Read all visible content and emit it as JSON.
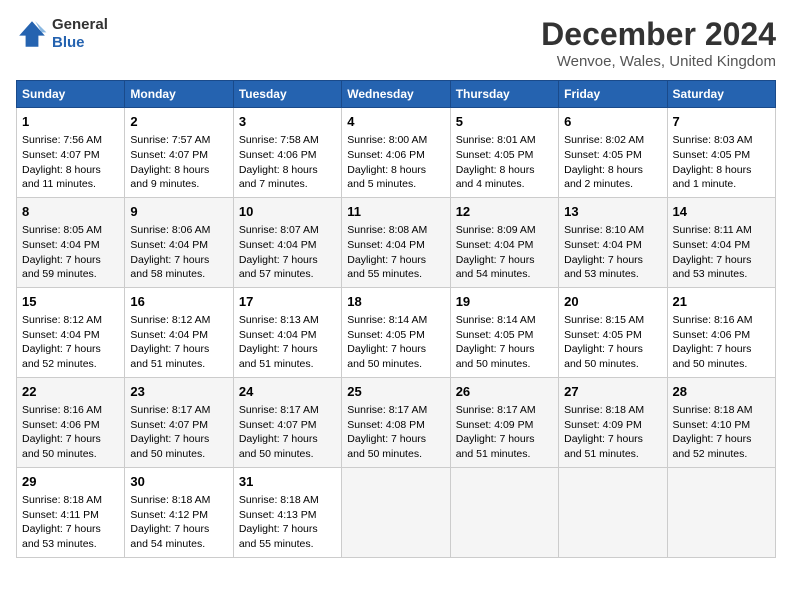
{
  "header": {
    "logo_line1": "General",
    "logo_line2": "Blue",
    "title": "December 2024",
    "subtitle": "Wenvoe, Wales, United Kingdom"
  },
  "columns": [
    "Sunday",
    "Monday",
    "Tuesday",
    "Wednesday",
    "Thursday",
    "Friday",
    "Saturday"
  ],
  "weeks": [
    [
      {
        "day": "1",
        "rise": "Sunrise: 7:56 AM",
        "set": "Sunset: 4:07 PM",
        "light": "Daylight: 8 hours and 11 minutes."
      },
      {
        "day": "2",
        "rise": "Sunrise: 7:57 AM",
        "set": "Sunset: 4:07 PM",
        "light": "Daylight: 8 hours and 9 minutes."
      },
      {
        "day": "3",
        "rise": "Sunrise: 7:58 AM",
        "set": "Sunset: 4:06 PM",
        "light": "Daylight: 8 hours and 7 minutes."
      },
      {
        "day": "4",
        "rise": "Sunrise: 8:00 AM",
        "set": "Sunset: 4:06 PM",
        "light": "Daylight: 8 hours and 5 minutes."
      },
      {
        "day": "5",
        "rise": "Sunrise: 8:01 AM",
        "set": "Sunset: 4:05 PM",
        "light": "Daylight: 8 hours and 4 minutes."
      },
      {
        "day": "6",
        "rise": "Sunrise: 8:02 AM",
        "set": "Sunset: 4:05 PM",
        "light": "Daylight: 8 hours and 2 minutes."
      },
      {
        "day": "7",
        "rise": "Sunrise: 8:03 AM",
        "set": "Sunset: 4:05 PM",
        "light": "Daylight: 8 hours and 1 minute."
      }
    ],
    [
      {
        "day": "8",
        "rise": "Sunrise: 8:05 AM",
        "set": "Sunset: 4:04 PM",
        "light": "Daylight: 7 hours and 59 minutes."
      },
      {
        "day": "9",
        "rise": "Sunrise: 8:06 AM",
        "set": "Sunset: 4:04 PM",
        "light": "Daylight: 7 hours and 58 minutes."
      },
      {
        "day": "10",
        "rise": "Sunrise: 8:07 AM",
        "set": "Sunset: 4:04 PM",
        "light": "Daylight: 7 hours and 57 minutes."
      },
      {
        "day": "11",
        "rise": "Sunrise: 8:08 AM",
        "set": "Sunset: 4:04 PM",
        "light": "Daylight: 7 hours and 55 minutes."
      },
      {
        "day": "12",
        "rise": "Sunrise: 8:09 AM",
        "set": "Sunset: 4:04 PM",
        "light": "Daylight: 7 hours and 54 minutes."
      },
      {
        "day": "13",
        "rise": "Sunrise: 8:10 AM",
        "set": "Sunset: 4:04 PM",
        "light": "Daylight: 7 hours and 53 minutes."
      },
      {
        "day": "14",
        "rise": "Sunrise: 8:11 AM",
        "set": "Sunset: 4:04 PM",
        "light": "Daylight: 7 hours and 53 minutes."
      }
    ],
    [
      {
        "day": "15",
        "rise": "Sunrise: 8:12 AM",
        "set": "Sunset: 4:04 PM",
        "light": "Daylight: 7 hours and 52 minutes."
      },
      {
        "day": "16",
        "rise": "Sunrise: 8:12 AM",
        "set": "Sunset: 4:04 PM",
        "light": "Daylight: 7 hours and 51 minutes."
      },
      {
        "day": "17",
        "rise": "Sunrise: 8:13 AM",
        "set": "Sunset: 4:04 PM",
        "light": "Daylight: 7 hours and 51 minutes."
      },
      {
        "day": "18",
        "rise": "Sunrise: 8:14 AM",
        "set": "Sunset: 4:05 PM",
        "light": "Daylight: 7 hours and 50 minutes."
      },
      {
        "day": "19",
        "rise": "Sunrise: 8:14 AM",
        "set": "Sunset: 4:05 PM",
        "light": "Daylight: 7 hours and 50 minutes."
      },
      {
        "day": "20",
        "rise": "Sunrise: 8:15 AM",
        "set": "Sunset: 4:05 PM",
        "light": "Daylight: 7 hours and 50 minutes."
      },
      {
        "day": "21",
        "rise": "Sunrise: 8:16 AM",
        "set": "Sunset: 4:06 PM",
        "light": "Daylight: 7 hours and 50 minutes."
      }
    ],
    [
      {
        "day": "22",
        "rise": "Sunrise: 8:16 AM",
        "set": "Sunset: 4:06 PM",
        "light": "Daylight: 7 hours and 50 minutes."
      },
      {
        "day": "23",
        "rise": "Sunrise: 8:17 AM",
        "set": "Sunset: 4:07 PM",
        "light": "Daylight: 7 hours and 50 minutes."
      },
      {
        "day": "24",
        "rise": "Sunrise: 8:17 AM",
        "set": "Sunset: 4:07 PM",
        "light": "Daylight: 7 hours and 50 minutes."
      },
      {
        "day": "25",
        "rise": "Sunrise: 8:17 AM",
        "set": "Sunset: 4:08 PM",
        "light": "Daylight: 7 hours and 50 minutes."
      },
      {
        "day": "26",
        "rise": "Sunrise: 8:17 AM",
        "set": "Sunset: 4:09 PM",
        "light": "Daylight: 7 hours and 51 minutes."
      },
      {
        "day": "27",
        "rise": "Sunrise: 8:18 AM",
        "set": "Sunset: 4:09 PM",
        "light": "Daylight: 7 hours and 51 minutes."
      },
      {
        "day": "28",
        "rise": "Sunrise: 8:18 AM",
        "set": "Sunset: 4:10 PM",
        "light": "Daylight: 7 hours and 52 minutes."
      }
    ],
    [
      {
        "day": "29",
        "rise": "Sunrise: 8:18 AM",
        "set": "Sunset: 4:11 PM",
        "light": "Daylight: 7 hours and 53 minutes."
      },
      {
        "day": "30",
        "rise": "Sunrise: 8:18 AM",
        "set": "Sunset: 4:12 PM",
        "light": "Daylight: 7 hours and 54 minutes."
      },
      {
        "day": "31",
        "rise": "Sunrise: 8:18 AM",
        "set": "Sunset: 4:13 PM",
        "light": "Daylight: 7 hours and 55 minutes."
      },
      null,
      null,
      null,
      null
    ]
  ]
}
